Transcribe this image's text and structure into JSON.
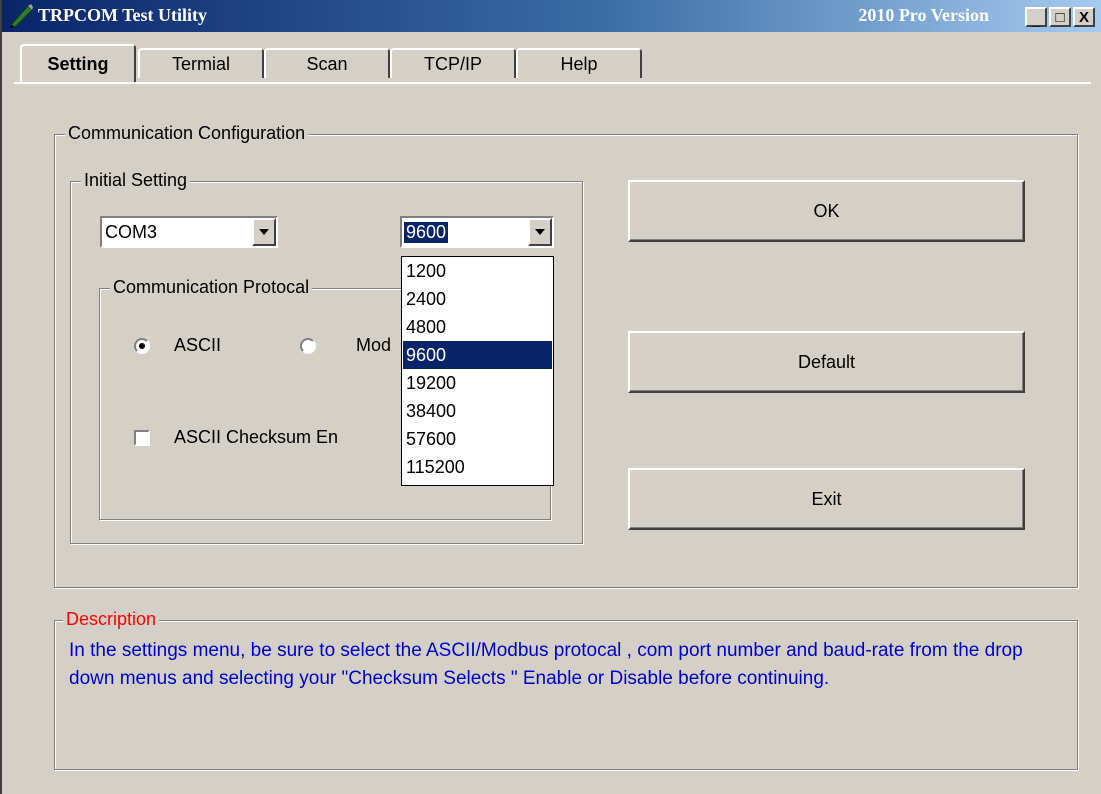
{
  "window": {
    "title": "TRPCOM Test Utility",
    "version": "2010 Pro Version",
    "controls": {
      "minimize": "_",
      "maximize": "□",
      "close": "X"
    }
  },
  "tabs": [
    {
      "label": "Setting",
      "active": true
    },
    {
      "label": "Termial",
      "active": false
    },
    {
      "label": "Scan",
      "active": false
    },
    {
      "label": "TCP/IP",
      "active": false
    },
    {
      "label": "Help",
      "active": false
    }
  ],
  "config": {
    "group_label": "Communication Configuration",
    "initial_setting": {
      "label": "Initial Setting",
      "com_port": "COM3",
      "baud_rate": "9600",
      "baud_options": [
        "1200",
        "2400",
        "4800",
        "9600",
        "19200",
        "38400",
        "57600",
        "115200"
      ],
      "baud_selected": "9600"
    },
    "protocol": {
      "label": "Communication Protocal",
      "ascii_label": "ASCII",
      "modbus_label": "Mod",
      "selected": "ASCII",
      "checksum_label": "ASCII Checksum En",
      "checksum_checked": false
    }
  },
  "buttons": {
    "ok": "OK",
    "default": "Default",
    "exit": "Exit"
  },
  "description": {
    "label": "Description",
    "text": "In the settings menu, be sure to select the ASCII/Modbus protocal , com port number and baud-rate from the drop down menus and selecting your \"Checksum Selects \" Enable or Disable before continuing."
  },
  "colors": {
    "title_gradient_start": "#0a246a",
    "title_gradient_end": "#a6caf0",
    "face": "#d4d0c8",
    "selection": "#0a246a",
    "description_label": "#ff0000",
    "description_text": "#0000cc"
  }
}
